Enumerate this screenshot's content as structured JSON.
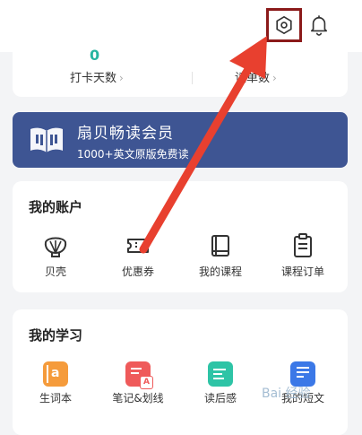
{
  "header": {
    "settings_icon": "settings-icon",
    "bell_icon": "bell-icon"
  },
  "stats": {
    "left": {
      "value": "0",
      "label": "打卡天数"
    },
    "right": {
      "label": "读单数"
    },
    "accent": "#27b5a0"
  },
  "member": {
    "title": "扇贝畅读会员",
    "subtitle": "1000+英文原版免费读",
    "color": "#3e5593",
    "icon": "open-book-icon"
  },
  "account": {
    "title": "我的账户",
    "items": [
      {
        "label": "贝壳",
        "icon": "shell-icon"
      },
      {
        "label": "优惠券",
        "icon": "coupon-icon"
      },
      {
        "label": "我的课程",
        "icon": "course-book-icon"
      },
      {
        "label": "课程订单",
        "icon": "order-clipboard-icon"
      }
    ]
  },
  "study": {
    "title": "我的学习",
    "items": [
      {
        "label": "生词本",
        "icon": "vocab-book-icon",
        "color": "#f59b3b"
      },
      {
        "label": "笔记&划线",
        "icon": "notes-icon",
        "color": "#ef5a5a"
      },
      {
        "label": "读后感",
        "icon": "review-icon",
        "color": "#2ec4a6"
      },
      {
        "label": "我的短文",
        "icon": "essay-icon",
        "color": "#3b78e7"
      }
    ]
  },
  "annotation": {
    "arrow_color": "#e8402f",
    "highlight_color": "#8b1a1a"
  },
  "watermark": {
    "text": "Bai 经验"
  }
}
